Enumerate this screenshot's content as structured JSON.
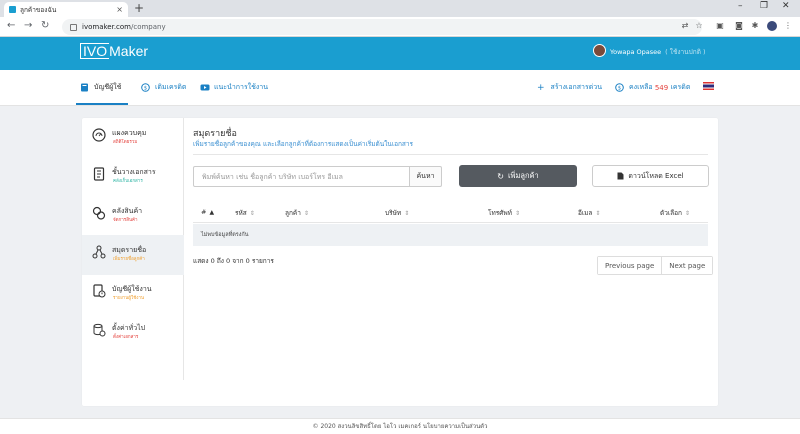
{
  "browser": {
    "tab_title": "ลูกค้าของฉัน",
    "tab_close": "×",
    "new_tab": "+",
    "url_host": "ivomaker.com",
    "url_path": "/company",
    "win_min": "–",
    "win_max": "❐",
    "win_close": "✕"
  },
  "header": {
    "logo_box": "IVO",
    "logo_rest": "Maker",
    "user_name": "Yowapa Opasee",
    "user_sub": "( ใช้งานปกติ )"
  },
  "topnav": {
    "items": [
      {
        "label": "บัญชีผู้ใช้"
      },
      {
        "label": "เติมเครดิต"
      },
      {
        "label": "แนะนำการใช้งาน"
      }
    ],
    "create_doc": "สร้างเอกสารด่วน",
    "credit_prefix": "คงเหลือ",
    "credit_value": "549",
    "credit_suffix": "เครดิต"
  },
  "sidebar": {
    "items": [
      {
        "title": "แผงควบคุม",
        "sub": "สถิติโดยรวม"
      },
      {
        "title": "ชั้นวางเอกสาร",
        "sub": "คลังเก็บเอกสาร"
      },
      {
        "title": "คลังสินค้า",
        "sub": "จัดการสินค้า"
      },
      {
        "title": "สมุดรายชื่อ",
        "sub": "เพิ่มรายชื่อลูกค้า"
      },
      {
        "title": "บัญชีผู้ใช้งาน",
        "sub": "รายงานผู้ใช้งาน"
      },
      {
        "title": "ตั้งค่าทั่วไป",
        "sub": "ตั้งค่าเอกสาร"
      }
    ]
  },
  "main": {
    "title": "สมุดรายชื่อ",
    "subtitle": "เพิ่มรายชื่อลูกค้าของคุณ และเลือกลูกค้าที่ต้องการแสดงเป็นค่าเริ่มต้นในเอกสาร",
    "search_placeholder": "พิมพ์ค้นหา เช่น ชื่อลูกค้า บริษัท เบอร์โทร อีเมล",
    "search_button": "ค้นหา",
    "add_button": "เพิ่มลูกค้า",
    "download_button": "ดาวน์โหลด Excel",
    "columns": [
      "#",
      "รหัส",
      "ลูกค้า",
      "บริษัท",
      "โทรศัพท์",
      "อีเมล",
      "ตัวเลือก"
    ],
    "empty_text": "ไม่พบข้อมูลที่ตรงกัน",
    "info_text": "แสดง 0 ถึง 0 จาก 0 รายการ",
    "prev_label": "Previous page",
    "next_label": "Next page"
  },
  "footer": {
    "text": "© 2020 สงวนลิขสิทธิ์โดย ไอโว เมคเกอร์ นโยบายความเป็นส่วนตัว"
  },
  "colors": {
    "brand": "#1a9ed0",
    "link": "#1a80c4",
    "credit": "#e4433e",
    "add_button": "#555a60"
  }
}
